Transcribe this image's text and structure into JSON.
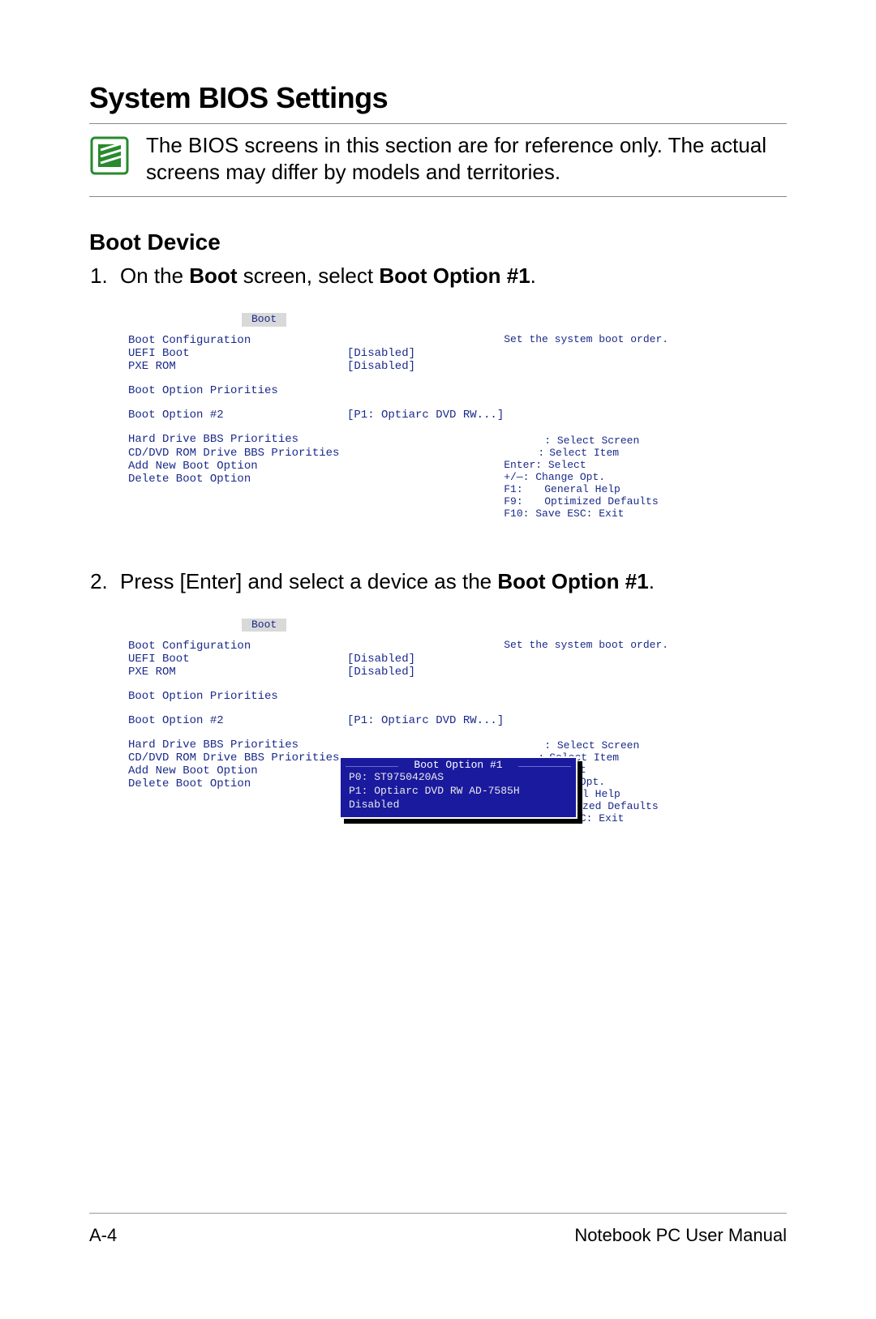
{
  "title": "System BIOS Settings",
  "note": "The BIOS screens in this section are for reference only. The actual screens may differ by models and territories.",
  "subhead": "Boot Device",
  "step1_pre": "On the ",
  "step1_b1": "Boot",
  "step1_mid": " screen, select ",
  "step1_b2": "Boot Option #1",
  "period": ".",
  "step2_pre": "Press [Enter] and select a device as the ",
  "step2_b1": "Boot Option #1",
  "bios": {
    "tab": "Boot",
    "hint": "Set the system boot order.",
    "left": {
      "cfg": "Boot Configuration",
      "uefi": "UEFI Boot",
      "pxe": "PXE ROM",
      "prio_hdr": "Boot Option Priorities",
      "opt2": "Boot Option #2",
      "hdd": "Hard Drive BBS Priorities",
      "cd": "CD/DVD ROM Drive BBS Priorities",
      "add": "Add New Boot Option",
      "del": "Delete Boot Option"
    },
    "mid": {
      "disabled": "[Disabled]",
      "opt2val": "[P1: Optiarc DVD RW...]"
    },
    "help": {
      "r1": ": Select Screen",
      "r2a": ":",
      "r2b": "Select Item",
      "r3": "Enter: Select",
      "r4": "+/—: Change Opt.",
      "r5a": "F1:",
      "r5b": "General Help",
      "r6a": "F9:",
      "r6b": "Optimized Defaults",
      "r7": "F10: Save   ESC: Exit"
    },
    "popup": {
      "title": "Boot Option #1",
      "i1": "P0: ST9750420AS",
      "i2": "P1: Optiarc DVD RW AD-7585H",
      "i3": "Disabled"
    }
  },
  "footer": {
    "left": "A-4",
    "right": "Notebook PC User Manual"
  }
}
